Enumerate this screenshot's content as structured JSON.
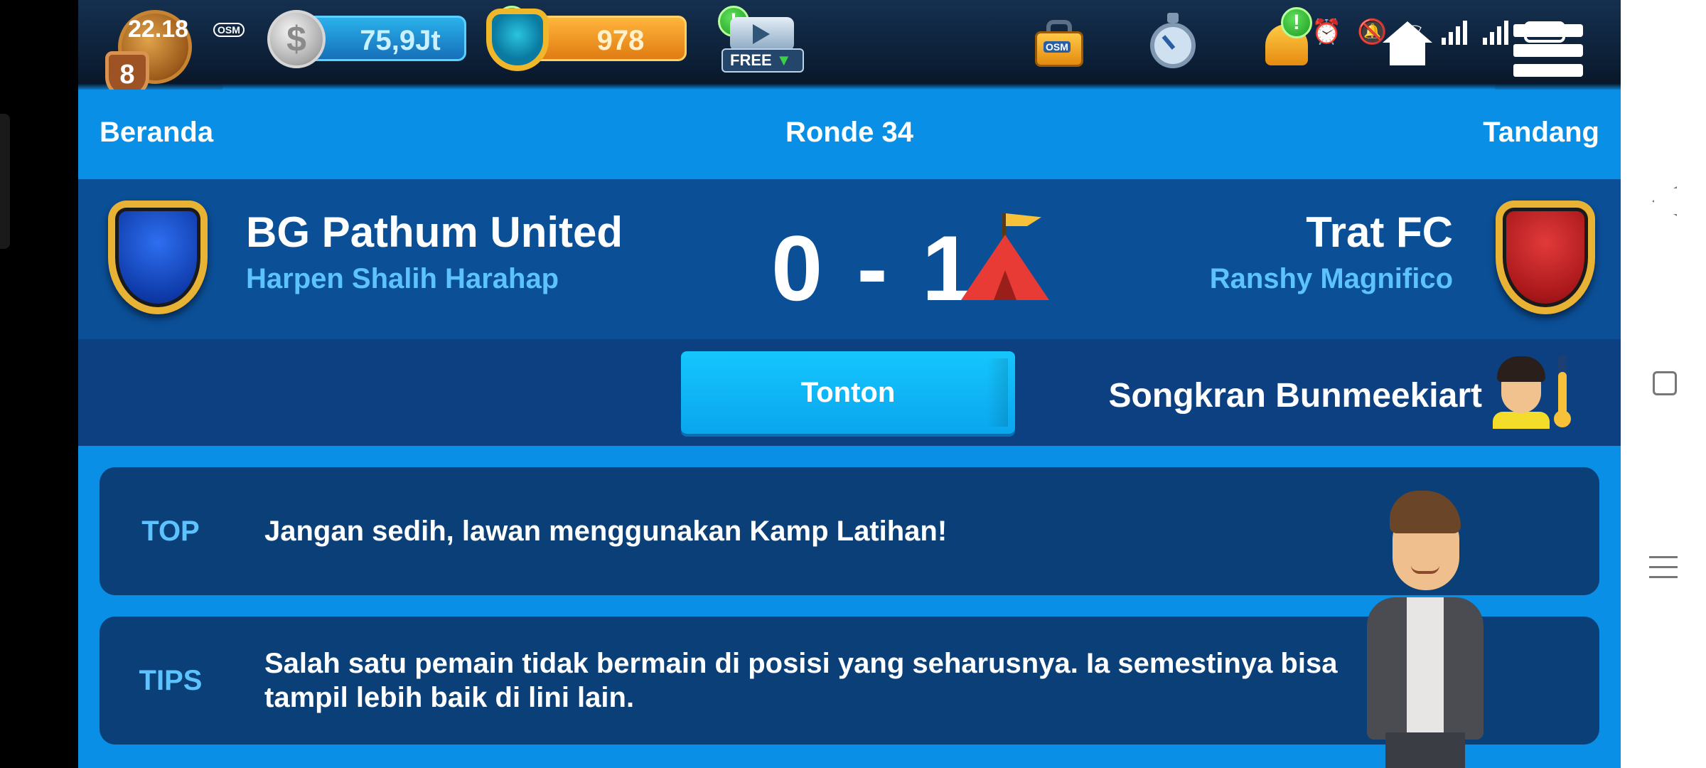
{
  "status_bar": {
    "time": "22.18",
    "osm_badge": "OSM"
  },
  "profile": {
    "level": "8"
  },
  "currency": {
    "money": "75,9Jt",
    "coins": "978",
    "money_alert": "!",
    "coins_alert": "!"
  },
  "top_icons": {
    "free_video_label": "FREE",
    "bag_label": "OSM",
    "bell_alert": "!"
  },
  "header": {
    "home_label": "Beranda",
    "round_label": "Ronde 34",
    "away_label": "Tandang"
  },
  "match": {
    "home_team": "BG Pathum United",
    "home_manager": "Harpen Shalih Harahap",
    "score": "0 - 1",
    "away_team": "Trat FC",
    "away_manager": "Ranshy Magnifico",
    "home_color": "#1b4fd0",
    "away_color": "#c0222a"
  },
  "watch": {
    "button_label": "Tonton",
    "referee_name": "Songkran Bunmeekiart"
  },
  "advice": [
    {
      "tag": "TOP",
      "message": "Jangan sedih, lawan menggunakan Kamp Latihan!"
    },
    {
      "tag": "TIPS",
      "message": "Salah satu pemain tidak bermain di posisi yang seharusnya. Ia semestinya bisa tampil lebih baik di lini lain."
    }
  ]
}
